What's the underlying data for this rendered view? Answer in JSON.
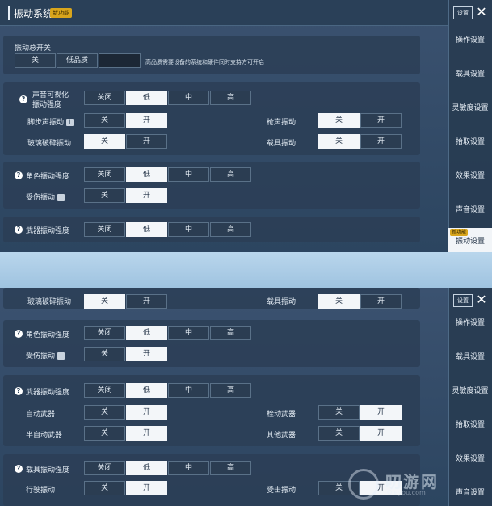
{
  "screen_a": {
    "title": "振动系统",
    "title_badge": "新功能",
    "master": {
      "label": "振动总开关",
      "options": [
        "关",
        "低品质"
      ],
      "note": "高品质需要设备的系统和硬件同时支持方可开启"
    },
    "sound_visual": {
      "label_line1": "声音可视化",
      "label_line2": "振动强度",
      "options": [
        "关闭",
        "低",
        "中",
        "高"
      ]
    },
    "footstep": {
      "label": "脚步声振动",
      "options": [
        "关",
        "开"
      ]
    },
    "gunshot": {
      "label": "枪声振动",
      "options": [
        "关",
        "开"
      ]
    },
    "glass": {
      "label": "玻璃破碎振动",
      "options": [
        "关",
        "开"
      ]
    },
    "vehicle": {
      "label": "载具振动",
      "options": [
        "关",
        "开"
      ]
    },
    "character": {
      "label": "角色振动强度",
      "options": [
        "关闭",
        "低",
        "中",
        "高"
      ]
    },
    "hurt": {
      "label": "受伤振动",
      "options": [
        "关",
        "开"
      ]
    },
    "weapon": {
      "label": "武器振动强度",
      "options": [
        "关闭",
        "低",
        "中",
        "高"
      ]
    }
  },
  "screen_b": {
    "glass": {
      "label": "玻璃破碎振动",
      "options": [
        "关",
        "开"
      ]
    },
    "vehicle": {
      "label": "载具振动",
      "options": [
        "关",
        "开"
      ]
    },
    "character": {
      "label": "角色振动强度",
      "options": [
        "关闭",
        "低",
        "中",
        "高"
      ]
    },
    "hurt": {
      "label": "受伤振动",
      "options": [
        "关",
        "开"
      ]
    },
    "weapon": {
      "label": "武器振动强度",
      "options": [
        "关闭",
        "低",
        "中",
        "高"
      ]
    },
    "auto_weapon": {
      "label": "自动武器",
      "options": [
        "关",
        "开"
      ]
    },
    "bolt_weapon": {
      "label": "栓动武器",
      "options": [
        "关",
        "开"
      ]
    },
    "semi_weapon": {
      "label": "半自动武器",
      "options": [
        "关",
        "开"
      ]
    },
    "other_weapon": {
      "label": "其他武器",
      "options": [
        "关",
        "开"
      ]
    },
    "vehicle_strength": {
      "label": "载具振动强度",
      "options": [
        "关闭",
        "低",
        "中",
        "高"
      ]
    },
    "driving": {
      "label": "行驶振动",
      "options": [
        "关",
        "开"
      ]
    },
    "hit": {
      "label": "受击振动",
      "options": [
        "关",
        "开"
      ]
    }
  },
  "sidebar": {
    "settings_btn": "设置",
    "items": [
      "操作设置",
      "载具设置",
      "灵敏度设置",
      "拾取设置",
      "效果设置",
      "声音设置",
      "振动设置"
    ],
    "active_tag": "新功能"
  },
  "info_mark": "i",
  "question_mark": "?",
  "close_glyph": "✕",
  "watermark": {
    "text": "叨游网",
    "sub": "Qieyou.com"
  },
  "colors": {
    "selected": "#f3f6f9",
    "accent": "#d8a51c",
    "panel": "#2b3e56"
  }
}
